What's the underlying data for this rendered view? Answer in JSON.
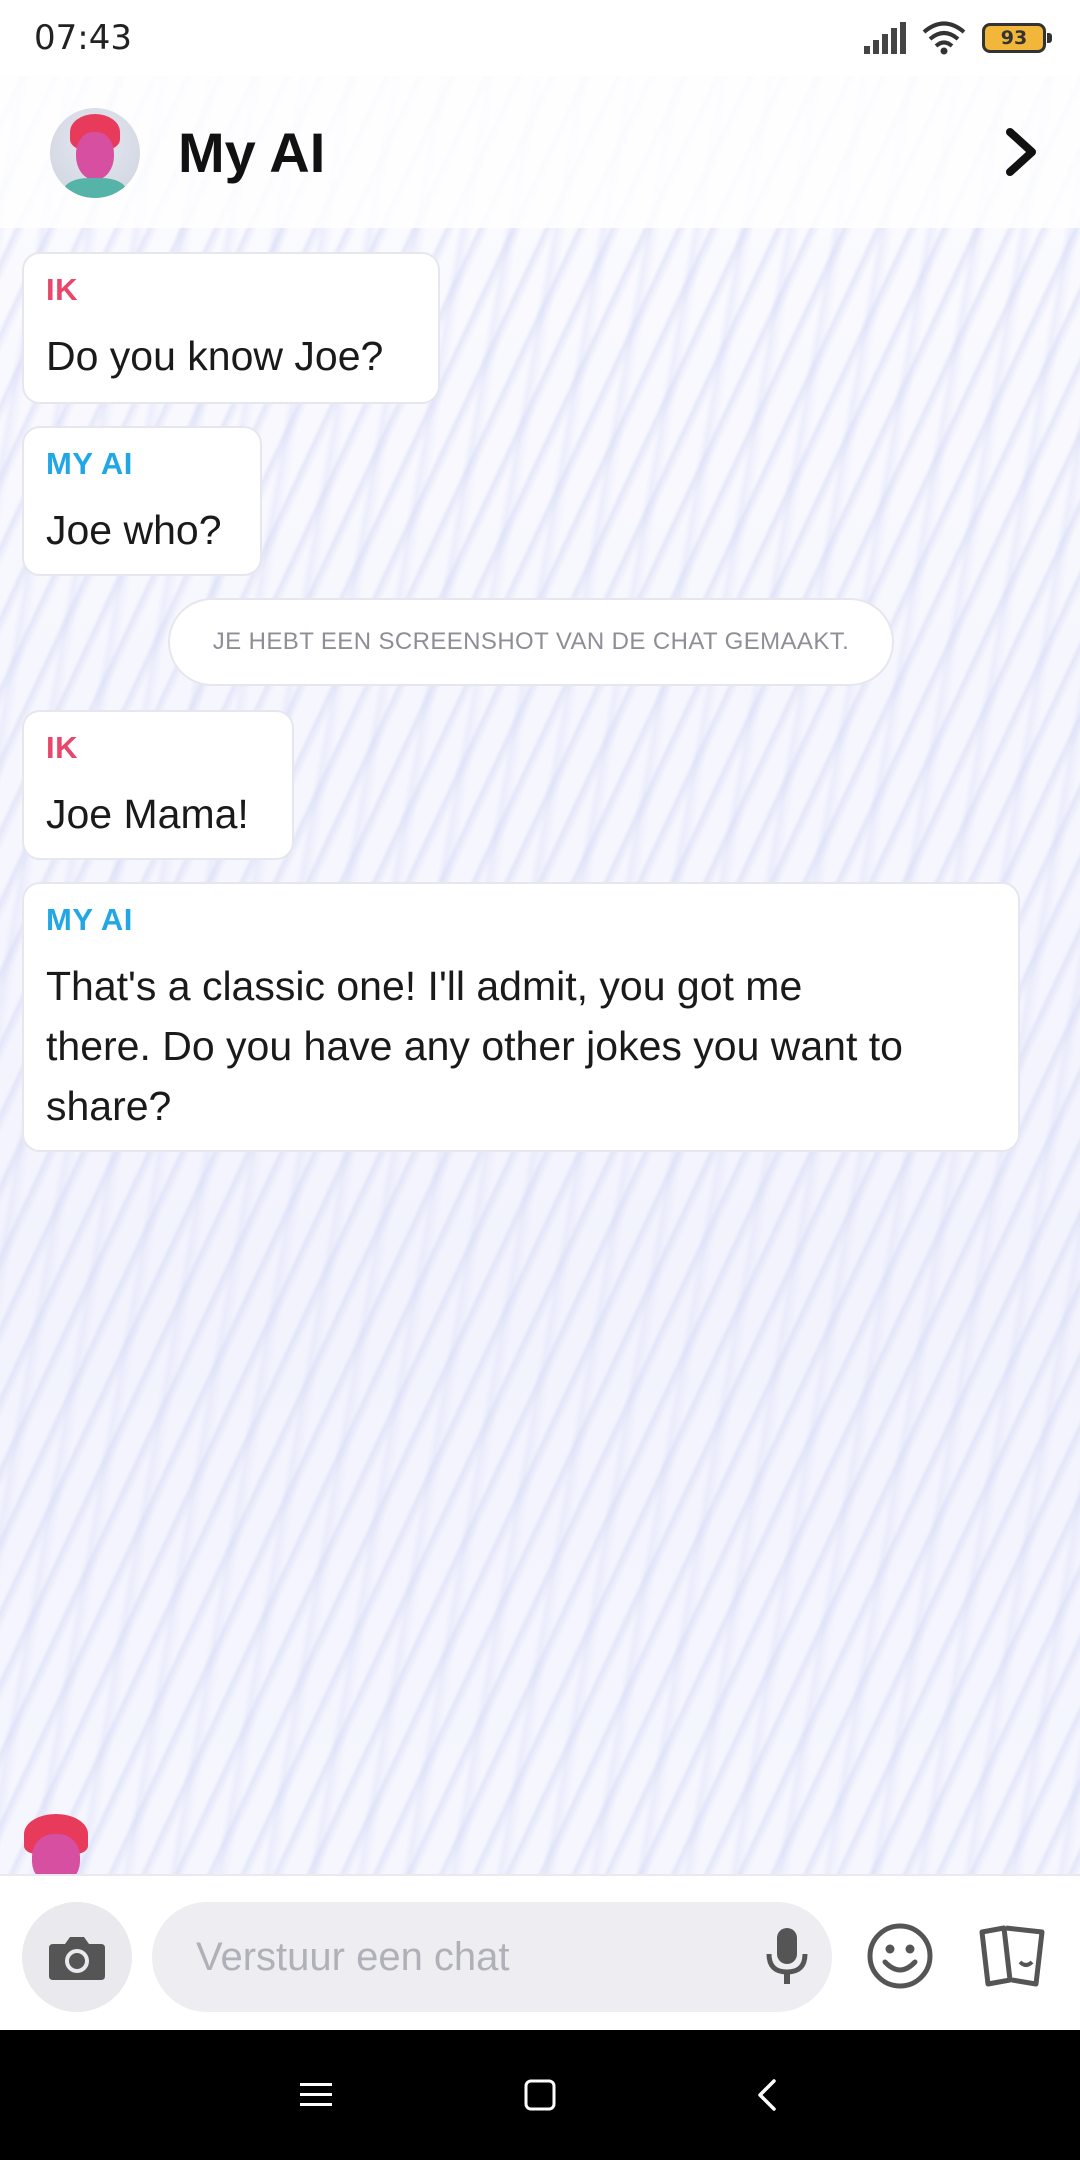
{
  "status": {
    "time": "07:43",
    "battery": "93"
  },
  "header": {
    "title": "My AI",
    "avatar": "bitmoji-avatar",
    "forward_icon": "chevron-right-icon"
  },
  "messages": [
    {
      "sender": "IK",
      "text": "Do you know Joe?"
    },
    {
      "sender": "MY AI",
      "text": "Joe who?"
    },
    {
      "system": "JE HEBT EEN SCREENSHOT VAN DE CHAT GEMAAKT."
    },
    {
      "sender": "IK",
      "text": "Joe Mama!"
    },
    {
      "sender": "MY AI",
      "text_lines": [
        "That's a classic one! I'll admit, you got me",
        "there. Do you have any other jokes you want to",
        "share?"
      ]
    }
  ],
  "input": {
    "placeholder": "Verstuur een chat"
  },
  "colors": {
    "me": "#e8466a",
    "ai": "#21a7e6"
  }
}
